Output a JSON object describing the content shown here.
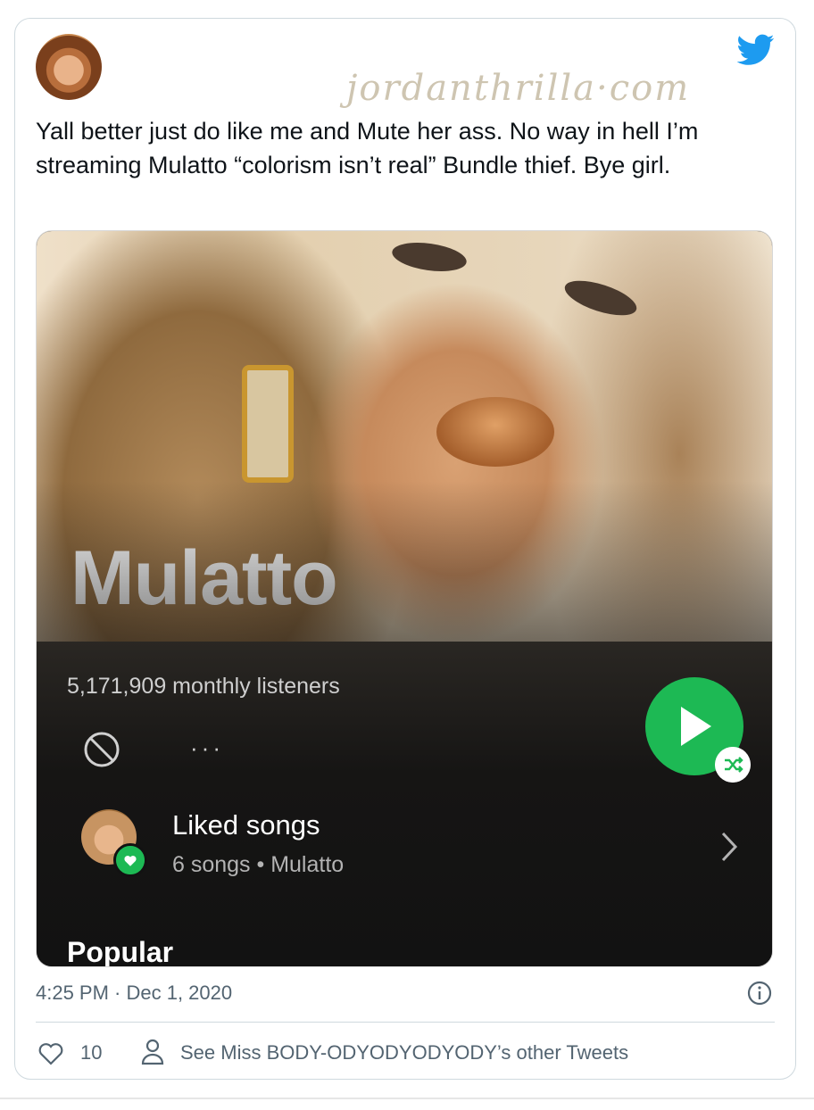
{
  "watermark": "jordanthrilla·com",
  "tweet": {
    "text": "Yall better just do like me and Mute her ass. No way in hell I’m streaming Mulatto “colorism isn’t real” Bundle thief. Bye girl.",
    "timestamp": "4:25 PM · Dec 1, 2020",
    "like_count": "10",
    "other_tweets_label": "See Miss BODY-ODYODYODYODY’s other Tweets"
  },
  "spotify": {
    "artist_name": "Mulatto",
    "monthly_listeners": "5,171,909 monthly listeners",
    "more_options": "···",
    "liked_songs_title": "Liked songs",
    "liked_songs_subtitle": "6 songs • Mulatto",
    "section_popular": "Popular"
  },
  "colors": {
    "spotify_green": "#1db954",
    "twitter_blue": "#1d9bf0",
    "panel_bg": "#121212"
  },
  "icons": [
    "twitter-icon",
    "block-icon",
    "play-icon",
    "shuffle-icon",
    "heart-icon",
    "chevron-right-icon",
    "info-icon",
    "like-icon",
    "person-icon"
  ]
}
